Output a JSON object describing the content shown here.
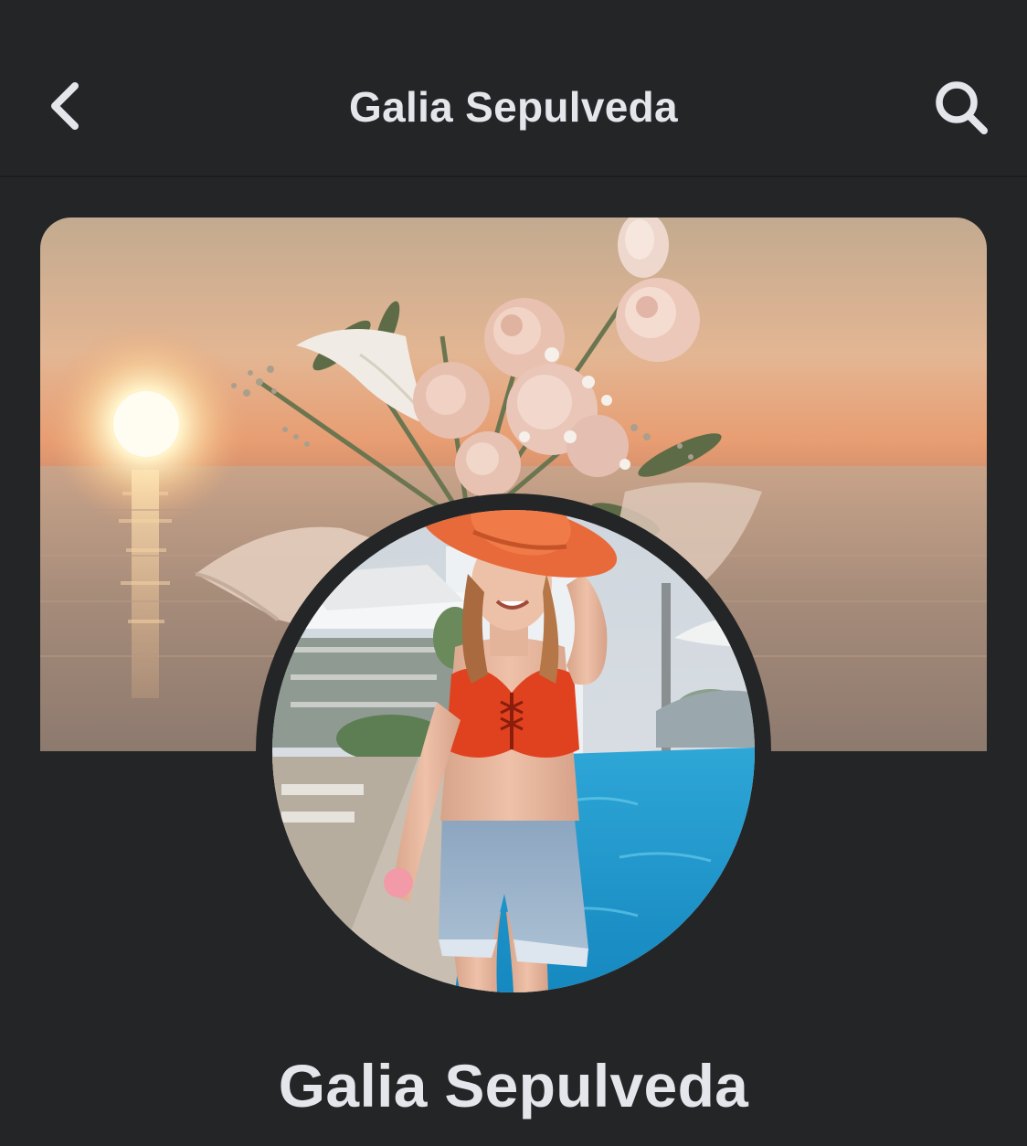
{
  "header": {
    "title": "Galia Sepulveda",
    "back_icon": "chevron-left-icon",
    "search_icon": "search-icon"
  },
  "profile": {
    "name": "Galia Sepulveda"
  },
  "colors": {
    "background": "#242526",
    "text": "#e4e6eb"
  }
}
